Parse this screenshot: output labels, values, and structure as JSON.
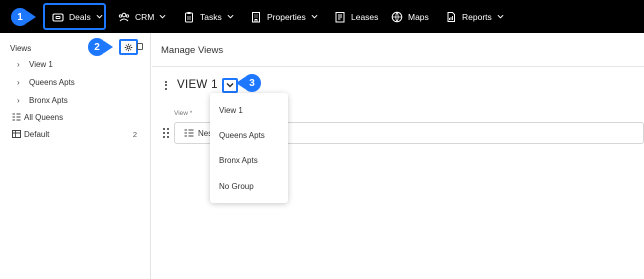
{
  "nav": {
    "items": [
      {
        "label": "Deals",
        "icon": "deals-icon",
        "chevron": true
      },
      {
        "label": "CRM",
        "icon": "crm-icon",
        "chevron": true
      },
      {
        "label": "Tasks",
        "icon": "tasks-icon",
        "chevron": true
      },
      {
        "label": "Properties",
        "icon": "properties-icon",
        "chevron": true
      },
      {
        "label": "Leases",
        "icon": "leases-icon",
        "chevron": false
      },
      {
        "label": "Maps",
        "icon": "maps-icon",
        "chevron": false
      },
      {
        "label": "Reports",
        "icon": "reports-icon",
        "chevron": true
      }
    ]
  },
  "badges": {
    "one": "1",
    "two": "2",
    "three": "3"
  },
  "sidebar": {
    "title": "Views",
    "groups": [
      {
        "label": "View 1"
      },
      {
        "label": "Queens Apts"
      },
      {
        "label": "Bronx Apts"
      }
    ],
    "flat": [
      {
        "label": "All Queens",
        "icon": "group-icon",
        "count": ""
      },
      {
        "label": "Default",
        "icon": "table-icon",
        "count": "2"
      }
    ]
  },
  "main": {
    "title": "Manage Views",
    "view_name": "VIEW 1",
    "field_label": "View *",
    "field_value": "Nes"
  },
  "dropdown": {
    "options": [
      "View 1",
      "Queens Apts",
      "Bronx Apts",
      "No Group"
    ]
  },
  "colors": {
    "accent": "#1e78ff",
    "nav_bg": "#000000"
  }
}
